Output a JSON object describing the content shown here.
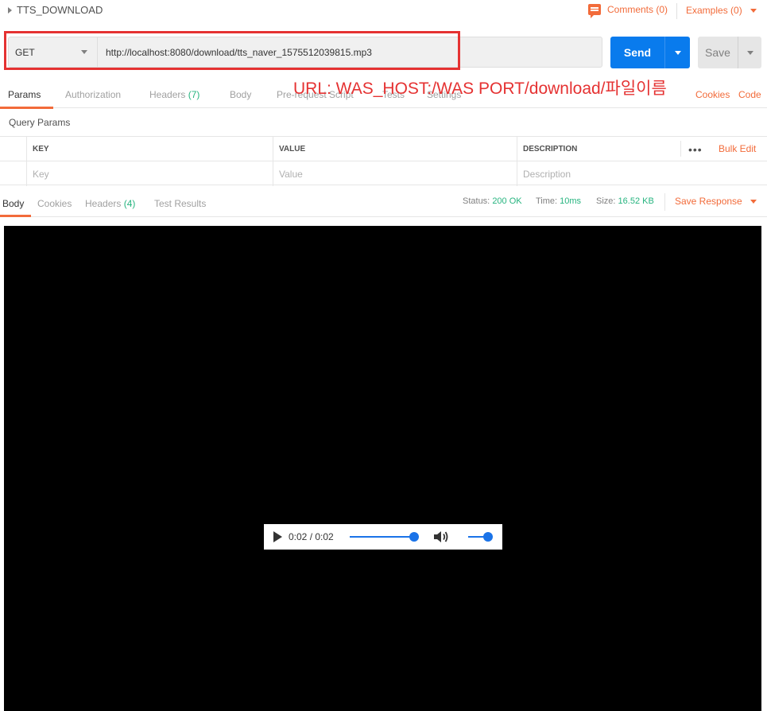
{
  "header": {
    "request_name": "TTS_DOWNLOAD",
    "comments": "Comments (0)",
    "examples": "Examples (0)"
  },
  "request": {
    "method": "GET",
    "url": "http://localhost:8080/download/tts_naver_1575512039815.mp3",
    "send_label": "Send",
    "save_label": "Save"
  },
  "annotation": "URL: WAS_HOST:/WAS PORT/download/파일이름",
  "request_tabs": {
    "params": "Params",
    "authorization": "Authorization",
    "headers": "Headers",
    "headers_count": "(7)",
    "body": "Body",
    "pre_request": "Pre-request Script",
    "tests": "Tests",
    "settings": "Settings",
    "cookies": "Cookies",
    "code": "Code"
  },
  "query_params": {
    "title": "Query Params",
    "columns": [
      "KEY",
      "VALUE",
      "DESCRIPTION"
    ],
    "placeholders": [
      "Key",
      "Value",
      "Description"
    ],
    "bulk_edit": "Bulk Edit"
  },
  "response_tabs": {
    "body": "Body",
    "cookies": "Cookies",
    "headers": "Headers",
    "headers_count": "(4)",
    "test_results": "Test Results"
  },
  "response_status": {
    "status_label": "Status:",
    "status_value": "200 OK",
    "time_label": "Time:",
    "time_value": "10ms",
    "size_label": "Size:",
    "size_value": "16.52 KB",
    "save_response": "Save Response"
  },
  "player": {
    "time": "0:02 / 0:02",
    "progress_fraction": 1.0,
    "volume_fraction": 1.0
  },
  "colors": {
    "accent_orange": "#f26b3a",
    "send_blue": "#097bed",
    "success_green": "#26b47f",
    "annotation_red": "#e53232"
  },
  "icons": {
    "play": "play-icon",
    "volume": "volume-icon",
    "comment": "comment-icon"
  }
}
